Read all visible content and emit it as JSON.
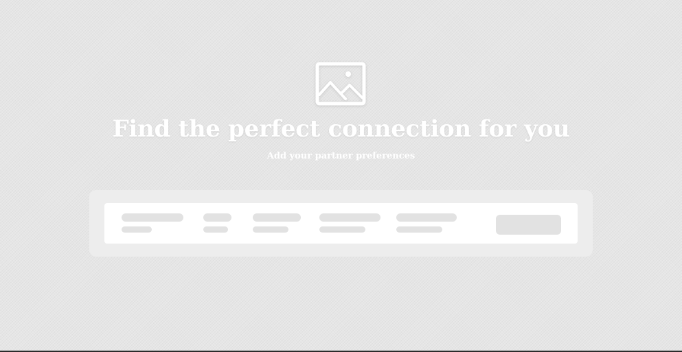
{
  "hero": {
    "icon": "image-placeholder-icon",
    "title": "Find the perfect connection for you",
    "subtitle": "Add your partner preferences"
  },
  "search": {
    "fields": [
      {
        "name": "preference-field-1"
      },
      {
        "name": "preference-field-2"
      },
      {
        "name": "preference-field-3"
      },
      {
        "name": "preference-field-4"
      },
      {
        "name": "preference-field-5"
      }
    ],
    "button": "search-button"
  },
  "colors": {
    "background": "#e6e6e6",
    "panel": "#ededed",
    "bar": "#ffffff",
    "skeleton": "#e2e2e2",
    "text": "#ffffff"
  }
}
